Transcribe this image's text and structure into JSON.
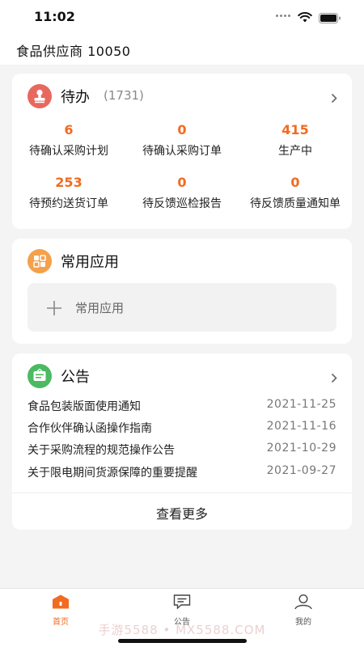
{
  "status_bar": {
    "time": "11:02"
  },
  "header": {
    "title": "食品供应商   10050"
  },
  "todo": {
    "title": "待办",
    "count": "(1731)",
    "stats": [
      {
        "value": "6",
        "label": "待确认采购计划"
      },
      {
        "value": "0",
        "label": "待确认采购订单"
      },
      {
        "value": "415",
        "label": "生产中"
      },
      {
        "value": "253",
        "label": "待预约送货订单"
      },
      {
        "value": "0",
        "label": "待反馈巡检报告"
      },
      {
        "value": "0",
        "label": "待反馈质量通知单"
      }
    ]
  },
  "apps": {
    "title": "常用应用",
    "add_label": "常用应用"
  },
  "notices": {
    "title": "公告",
    "items": [
      {
        "title": "食品包装版面使用通知",
        "date": "2021-11-25"
      },
      {
        "title": "合作伙伴确认函操作指南",
        "date": "2021-11-16"
      },
      {
        "title": "关于采购流程的规范操作公告",
        "date": "2021-10-29"
      },
      {
        "title": "关于限电期间货源保障的重要提醒",
        "date": "2021-09-27"
      }
    ],
    "more_label": "查看更多"
  },
  "tabbar": {
    "tabs": [
      {
        "label": "首页",
        "active": true
      },
      {
        "label": "公告",
        "active": false
      },
      {
        "label": "我的",
        "active": false
      }
    ],
    "watermark": "手游5588 • MX5588.COM"
  },
  "colors": {
    "accent": "#f26b21",
    "todo_icon": "#e8685f",
    "apps_icon": "#f5a04b",
    "notice_icon": "#4cb963"
  }
}
